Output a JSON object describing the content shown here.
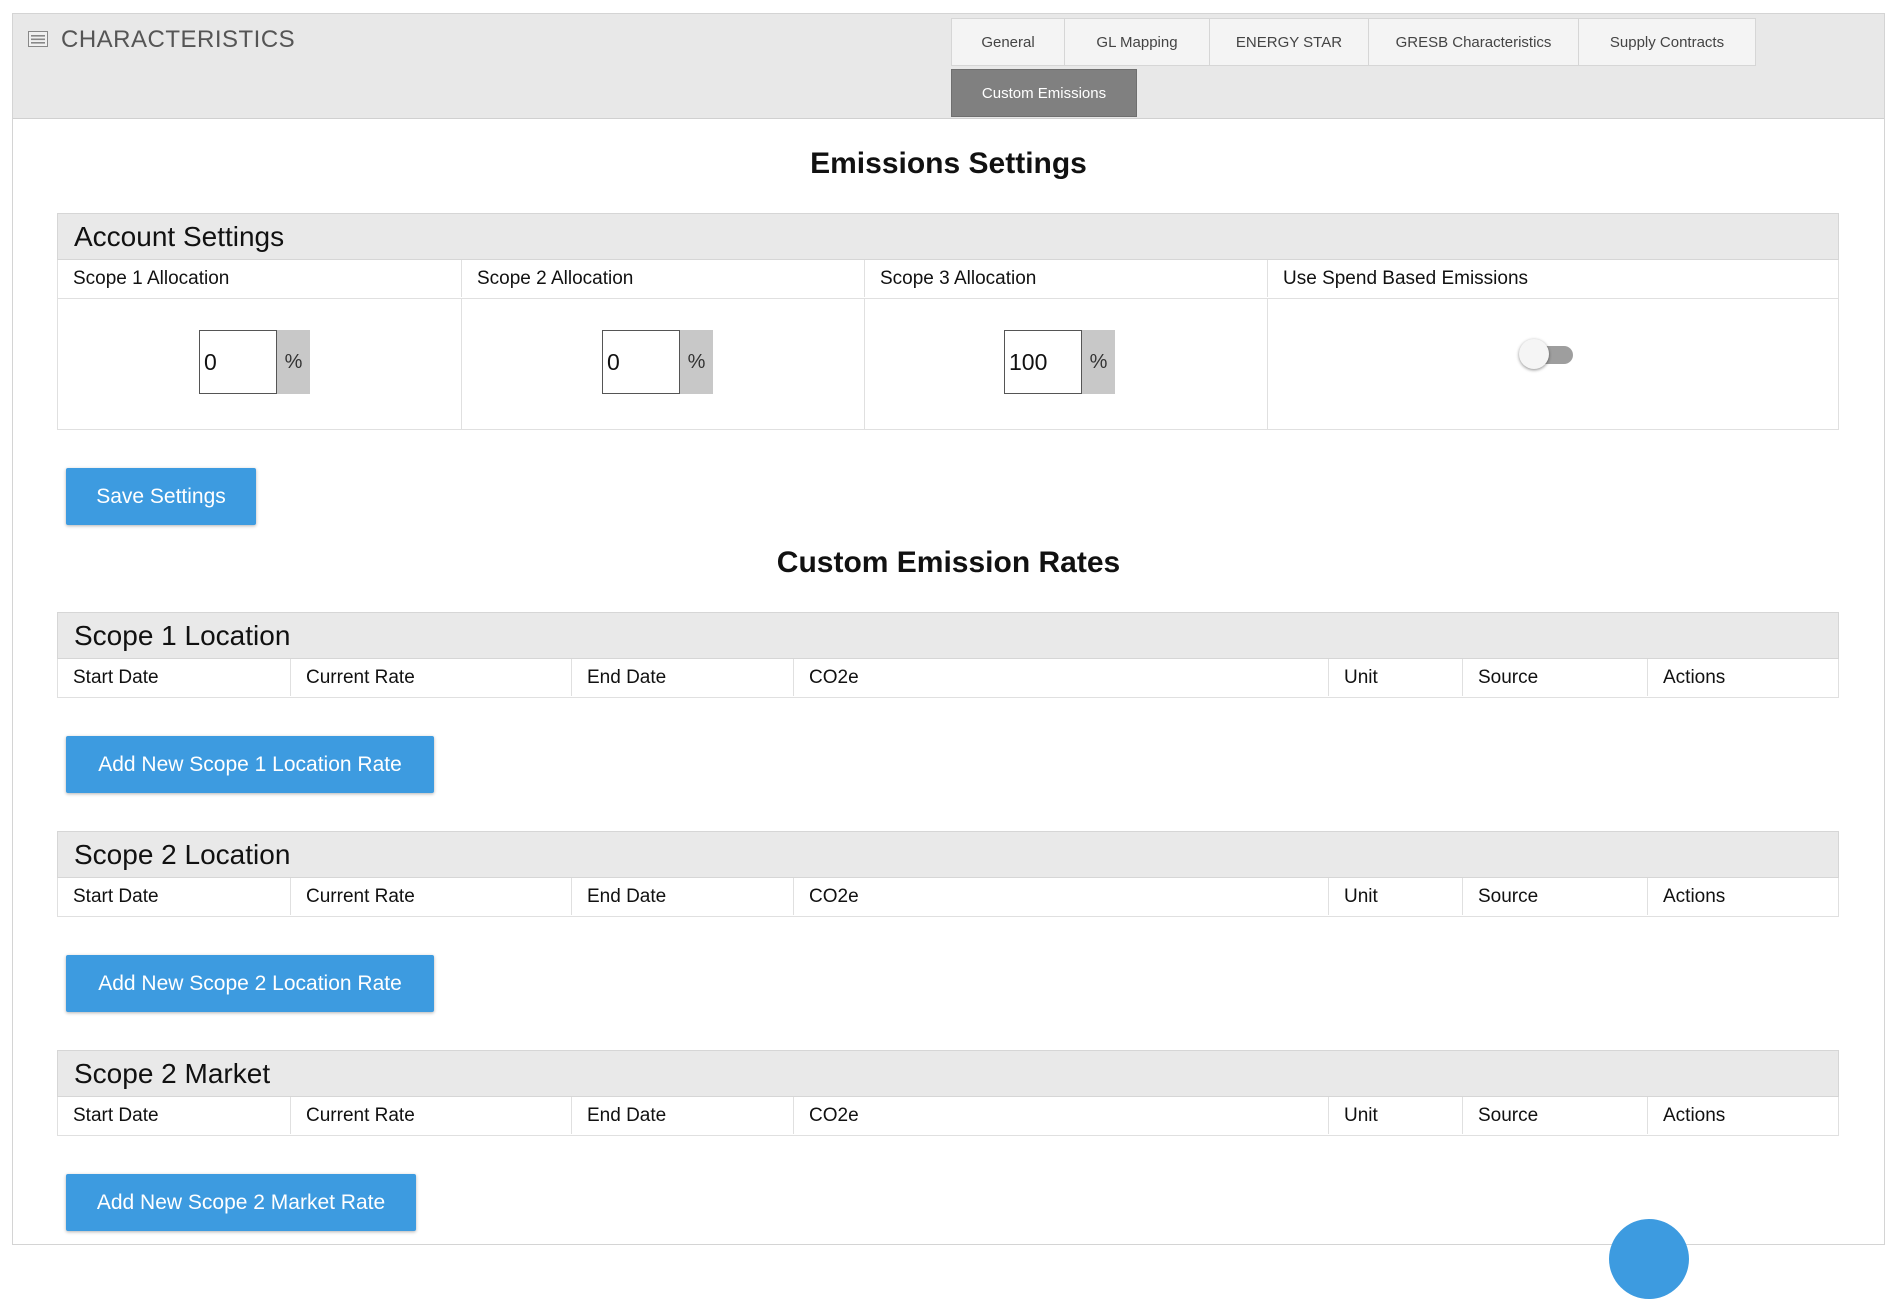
{
  "panel": {
    "title": "CHARACTERISTICS",
    "icon": "list-icon"
  },
  "tabs": [
    {
      "label": "General",
      "active": false
    },
    {
      "label": "GL Mapping",
      "active": false
    },
    {
      "label": "ENERGY STAR",
      "active": false
    },
    {
      "label": "GRESB Characteristics",
      "active": false
    },
    {
      "label": "Supply Contracts",
      "active": false
    },
    {
      "label": "Custom Emissions",
      "active": true
    }
  ],
  "emissions_settings": {
    "title": "Emissions Settings",
    "section_title": "Account Settings",
    "columns": [
      "Scope 1 Allocation",
      "Scope 2 Allocation",
      "Scope 3 Allocation",
      "Use Spend Based Emissions"
    ],
    "scope1_value": "0",
    "scope2_value": "0",
    "scope3_value": "100",
    "percent_symbol": "%",
    "spend_based_enabled": false,
    "save_label": "Save Settings"
  },
  "custom_rates": {
    "title": "Custom Emission Rates",
    "columns": [
      "Start Date",
      "Current Rate",
      "End Date",
      "CO2e",
      "Unit",
      "Source",
      "Actions"
    ],
    "sections": [
      {
        "title": "Scope 1 Location",
        "button": "Add New Scope 1 Location Rate"
      },
      {
        "title": "Scope 2 Location",
        "button": "Add New Scope 2 Location Rate"
      },
      {
        "title": "Scope 2 Market",
        "button": "Add New Scope 2 Market Rate"
      }
    ]
  },
  "colors": {
    "primary": "#3d9be0",
    "active_tab": "#808080",
    "header_bg": "#e8e8e8"
  }
}
